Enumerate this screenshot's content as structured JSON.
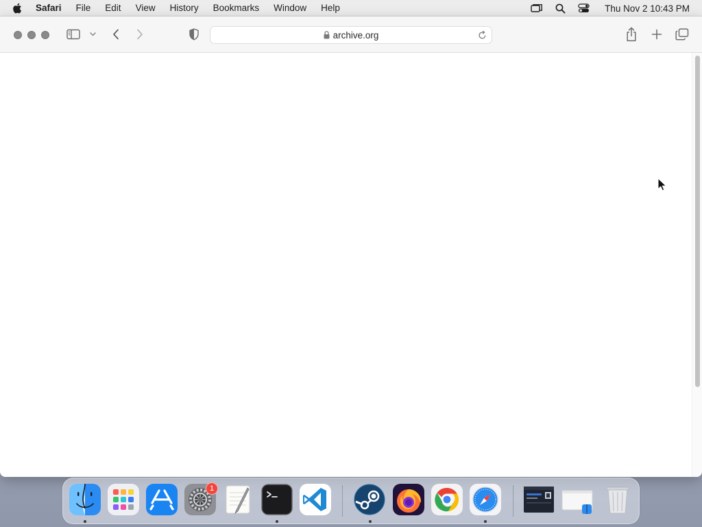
{
  "menubar": {
    "apple_icon": "apple-logo-icon",
    "app_name": "Safari",
    "items": [
      "File",
      "Edit",
      "View",
      "History",
      "Bookmarks",
      "Window",
      "Help"
    ],
    "status_icons": [
      "screen-mirroring-icon",
      "spotlight-search-icon",
      "control-center-icon"
    ],
    "clock": "Thu Nov 2  10:43 PM"
  },
  "safari": {
    "url": "archive.org",
    "toolbar_icons": [
      "sidebar-icon",
      "chevron-down-icon",
      "back-icon",
      "forward-icon",
      "privacy-shield-icon",
      "lock-icon",
      "reload-icon",
      "share-icon",
      "new-tab-icon",
      "tab-overview-icon"
    ]
  },
  "dock": {
    "apps": [
      {
        "name": "Finder",
        "icon": "finder-icon",
        "running": true
      },
      {
        "name": "Launchpad",
        "icon": "launchpad-icon",
        "running": false
      },
      {
        "name": "App Store",
        "icon": "app-store-icon",
        "running": false
      },
      {
        "name": "System Settings",
        "icon": "system-settings-icon",
        "running": false,
        "badge": "1"
      },
      {
        "name": "TextEdit",
        "icon": "textedit-icon",
        "running": false
      },
      {
        "name": "Terminal",
        "icon": "terminal-icon",
        "running": true
      },
      {
        "name": "Visual Studio Code",
        "icon": "vscode-icon",
        "running": false
      },
      {
        "name": "Steam",
        "icon": "steam-icon",
        "running": true
      },
      {
        "name": "Firefox",
        "icon": "firefox-icon",
        "running": false
      },
      {
        "name": "Google Chrome",
        "icon": "chrome-icon",
        "running": false
      },
      {
        "name": "Safari",
        "icon": "safari-icon",
        "running": true
      },
      {
        "name": "Window thumbnail",
        "icon": "window-thumbnail-icon",
        "running": false
      },
      {
        "name": "Finder window thumbnail",
        "icon": "finder-window-thumbnail-icon",
        "running": false
      },
      {
        "name": "Trash",
        "icon": "trash-icon",
        "running": false
      }
    ]
  },
  "colors": {
    "menubar_bg": "#ececec",
    "toolbar_bg": "#f6f6f6",
    "badge": "#f0463c",
    "vscode_blue": "#1f8ad2",
    "app_store_blue": "#1a84f2"
  }
}
